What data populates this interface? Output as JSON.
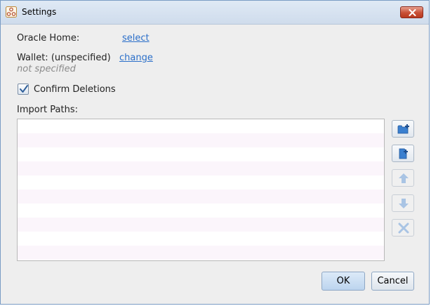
{
  "window": {
    "title": "Settings"
  },
  "oracle_home": {
    "label": "Oracle Home:",
    "link": "select"
  },
  "wallet": {
    "label": "Wallet: (unspecified)",
    "link": "change",
    "hint": "not specified"
  },
  "confirm_deletions": {
    "label": "Confirm Deletions",
    "checked": true
  },
  "import_paths": {
    "label": "Import Paths:",
    "items": []
  },
  "side_buttons": [
    {
      "icon": "add-folder-icon",
      "enabled": true
    },
    {
      "icon": "add-file-icon",
      "enabled": true
    },
    {
      "icon": "arrow-up-icon",
      "enabled": false
    },
    {
      "icon": "arrow-down-icon",
      "enabled": false
    },
    {
      "icon": "remove-icon",
      "enabled": false
    }
  ],
  "buttons": {
    "ok": "OK",
    "cancel": "Cancel"
  },
  "colors": {
    "link": "#2b6fc9",
    "title_bar": "#d6e2ef",
    "close_button": "#c84f35",
    "icon_blue": "#3a7fcf"
  }
}
